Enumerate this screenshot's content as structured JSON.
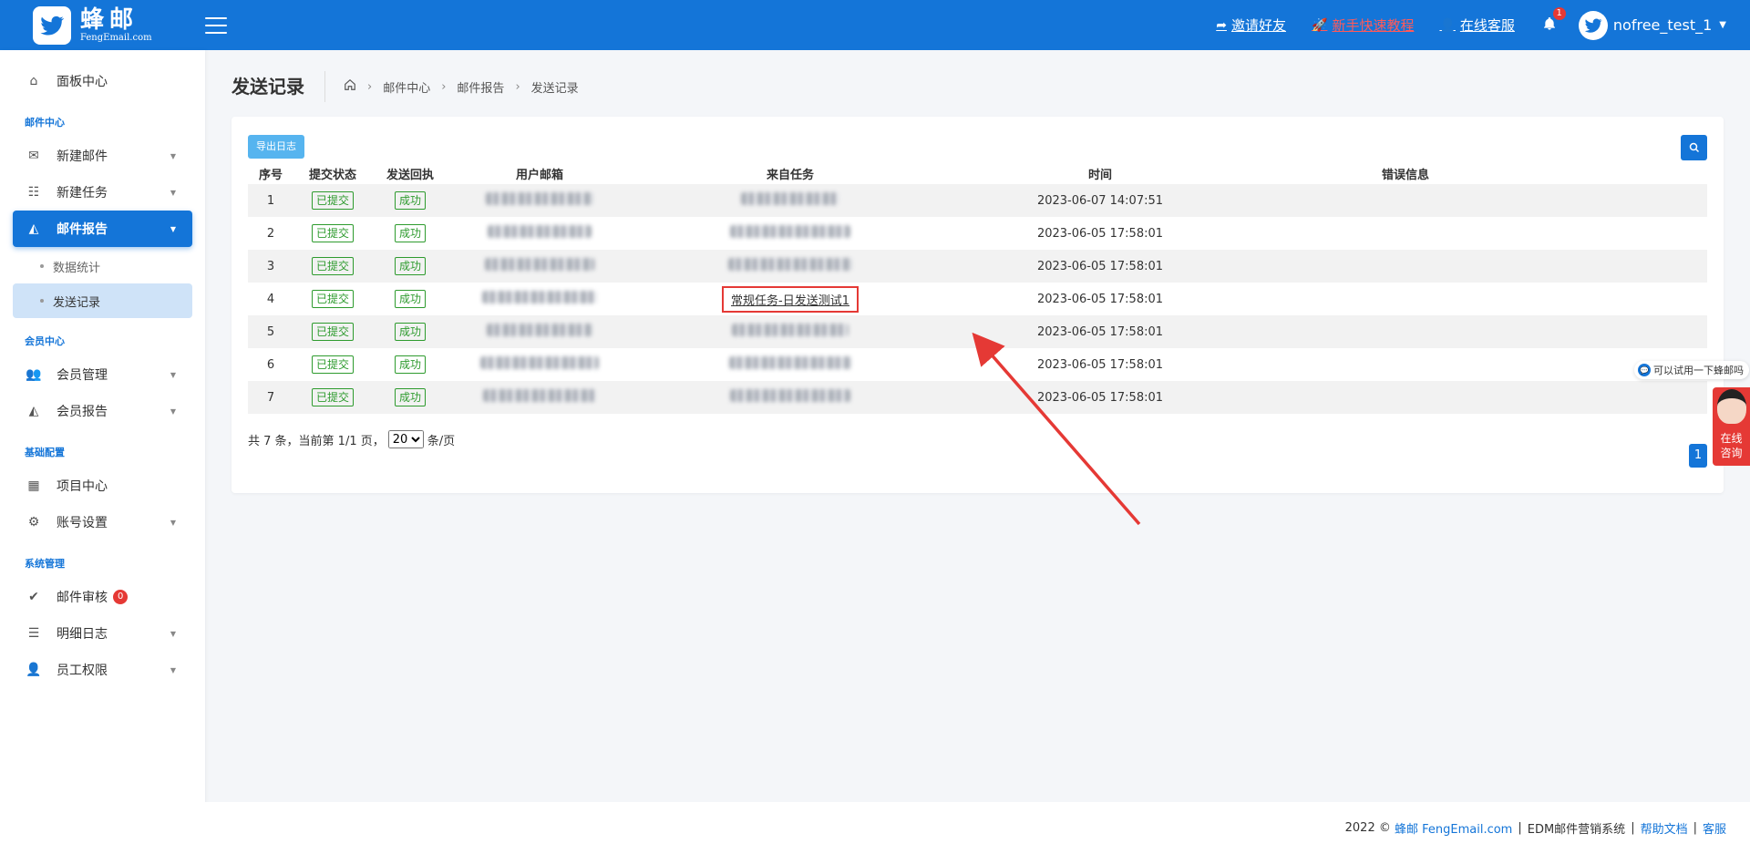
{
  "brand": {
    "name_cn": "蜂邮",
    "name_en": "FengEmail.com"
  },
  "header": {
    "links": [
      {
        "label": "邀请好友",
        "icon": "share-icon"
      },
      {
        "label": "新手快速教程",
        "icon": "rocket-icon"
      },
      {
        "label": "在线客服",
        "icon": "user-icon"
      }
    ],
    "notification_count": "1",
    "username": "nofree_test_1"
  },
  "sidebar": {
    "dashboard": "面板中心",
    "sections": {
      "mail": "邮件中心",
      "member": "会员中心",
      "basic": "基础配置",
      "system": "系统管理"
    },
    "items": {
      "new_mail": "新建邮件",
      "new_task": "新建任务",
      "mail_report": "邮件报告",
      "data_stats": "数据统计",
      "send_records": "发送记录",
      "member_manage": "会员管理",
      "member_report": "会员报告",
      "project_center": "项目中心",
      "account_settings": "账号设置",
      "mail_review": "邮件审核",
      "mail_review_count": "0",
      "detail_log": "明细日志",
      "staff_permissions": "员工权限"
    }
  },
  "page": {
    "title": "发送记录",
    "breadcrumb": [
      "邮件中心",
      "邮件报告",
      "发送记录"
    ]
  },
  "toolbar": {
    "export_label": "导出日志"
  },
  "table": {
    "headers": [
      "序号",
      "提交状态",
      "发送回执",
      "用户邮箱",
      "来自任务",
      "时间",
      "错误信息"
    ],
    "rows": [
      {
        "no": "1",
        "status": "已提交",
        "receipt": "成功",
        "time": "2023-06-07 14:07:51"
      },
      {
        "no": "2",
        "status": "已提交",
        "receipt": "成功",
        "time": "2023-06-05 17:58:01"
      },
      {
        "no": "3",
        "status": "已提交",
        "receipt": "成功",
        "time": "2023-06-05 17:58:01"
      },
      {
        "no": "4",
        "status": "已提交",
        "receipt": "成功",
        "task": "常规任务-日发送测试1",
        "time": "2023-06-05 17:58:01"
      },
      {
        "no": "5",
        "status": "已提交",
        "receipt": "成功",
        "time": "2023-06-05 17:58:01"
      },
      {
        "no": "6",
        "status": "已提交",
        "receipt": "成功",
        "time": "2023-06-05 17:58:01"
      },
      {
        "no": "7",
        "status": "已提交",
        "receipt": "成功",
        "time": "2023-06-05 17:58:01"
      }
    ]
  },
  "pagination": {
    "prefix": "共 7 条，当前第 1/1 页，",
    "page_size": "20",
    "suffix": "条/页",
    "current": "1"
  },
  "footer": {
    "year": "2022 ©",
    "brand_link": "蜂邮 FengEmail.com",
    "system": "EDM邮件营销系统",
    "help": "帮助文档",
    "service": "客服"
  },
  "floating": {
    "bubble": "可以试用一下蜂邮吗",
    "chat_line1": "在线",
    "chat_line2": "咨询"
  },
  "colors": {
    "primary": "#1475d8",
    "success": "#2e9b2e",
    "danger": "#e53935"
  }
}
